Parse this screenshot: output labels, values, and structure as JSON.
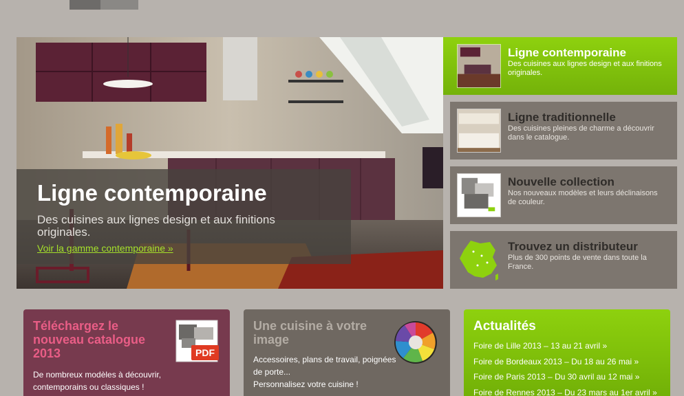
{
  "hero": {
    "title": "Ligne contemporaine",
    "description": "Des cuisines aux lignes design et aux finitions originales.",
    "link": "Voir la gamme contemporaine »"
  },
  "nav": {
    "items": [
      {
        "title": "Ligne contemporaine",
        "description": "Des cuisines aux lignes design et aux finitions originales.",
        "active": true
      },
      {
        "title": "Ligne traditionnelle",
        "description": "Des cuisines pleines de charme a découvrir dans le catalogue."
      },
      {
        "title": "Nouvelle collection",
        "description": "Nos nouveaux modèles et leurs déclinaisons de couleur."
      },
      {
        "title": "Trouvez un distributeur",
        "description": "Plus de 300 points de vente dans toute la France."
      }
    ]
  },
  "catalogue": {
    "title": "Téléchargez le nouveau catalogue 2013",
    "description": "De nombreux modèles à découvrir, contemporains ou classiques !",
    "badge": "PDF"
  },
  "custom": {
    "title": "Une cuisine à votre image",
    "description_1": "Accessoires, plans de travail, poignées de porte...",
    "description_2": "Personnalisez votre cuisine !"
  },
  "news": {
    "title": "Actualités",
    "items": [
      "Foire de Lille 2013 – 13 au 21 avril »",
      "Foire de Bordeaux 2013 – Du 18 au 26 mai »",
      "Foire de Paris 2013 – Du 30 avril au 12 mai »",
      "Foire de Rennes 2013 – Du 23 mars au 1er avril »"
    ]
  },
  "colors": {
    "accent_green": "#8ed10e",
    "catalogue_box": "#773a4e",
    "catalogue_title": "#e95d86",
    "nav_bg": "#7d766f",
    "page_bg": "#b7b2ad"
  }
}
